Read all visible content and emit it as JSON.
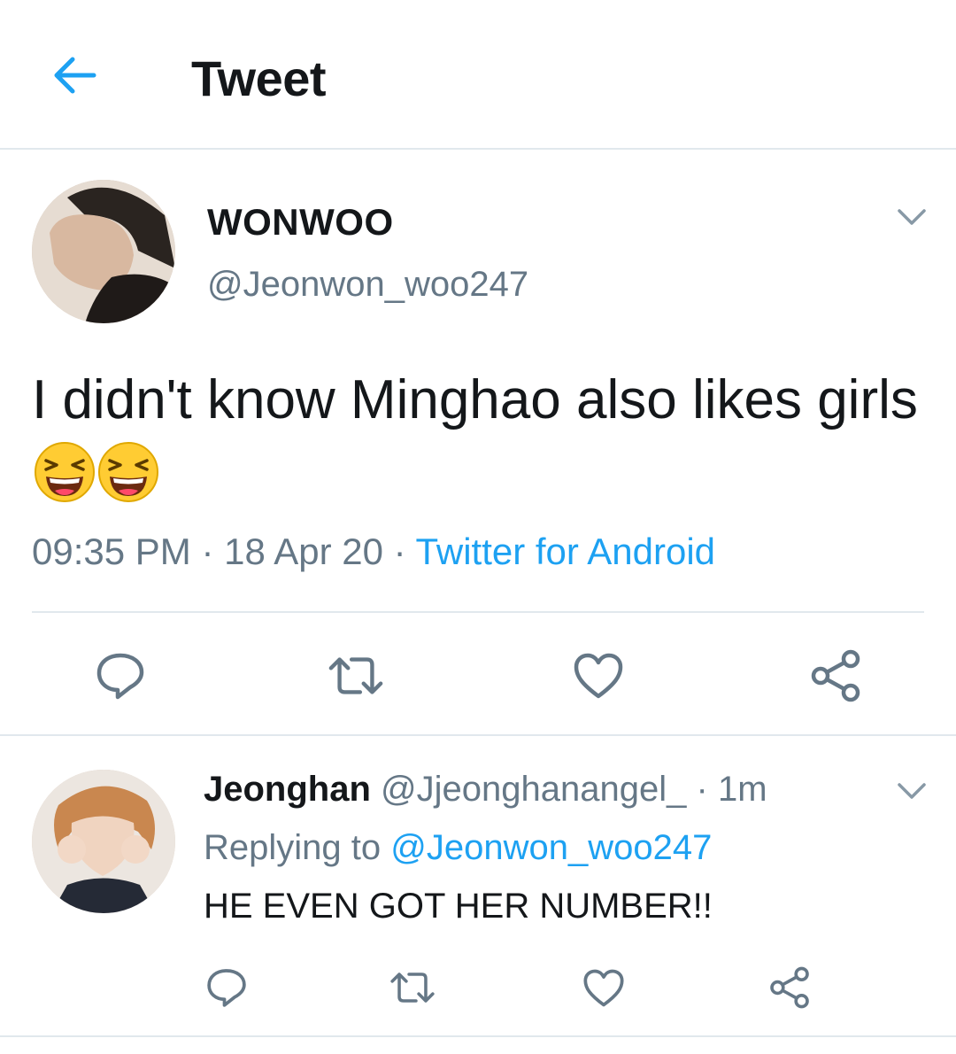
{
  "header": {
    "back_icon": "arrow-left-icon",
    "title": "Tweet",
    "accent_color": "#1da1f2"
  },
  "tweet": {
    "avatar": "avatar-photo",
    "display_name": "WONWOO",
    "handle": "@Jeonwon_woo247",
    "menu_icon": "chevron-down-icon",
    "text": "I didn't know Minghao also likes girls",
    "emojis": [
      "laughing-face-emoji",
      "laughing-face-emoji"
    ],
    "time": "09:35 PM",
    "date": "18 Apr 20",
    "separator": "·",
    "source": "Twitter for Android",
    "actions": [
      "reply-icon",
      "retweet-icon",
      "like-icon",
      "share-icon"
    ]
  },
  "reply": {
    "avatar": "avatar-photo",
    "display_name": "Jeonghan",
    "handle": "@Jjeonghanangel_",
    "separator": "·",
    "time": "1m",
    "replying_prefix": "Replying to",
    "replying_to": "@Jeonwon_woo247",
    "text": "HE EVEN GOT HER NUMBER!!",
    "menu_icon": "chevron-down-icon",
    "actions": [
      "reply-icon",
      "retweet-icon",
      "like-icon",
      "share-icon"
    ]
  },
  "colors": {
    "text": "#14171a",
    "secondary": "#657786",
    "link": "#1da1f2",
    "divider": "#e1e8ed"
  }
}
